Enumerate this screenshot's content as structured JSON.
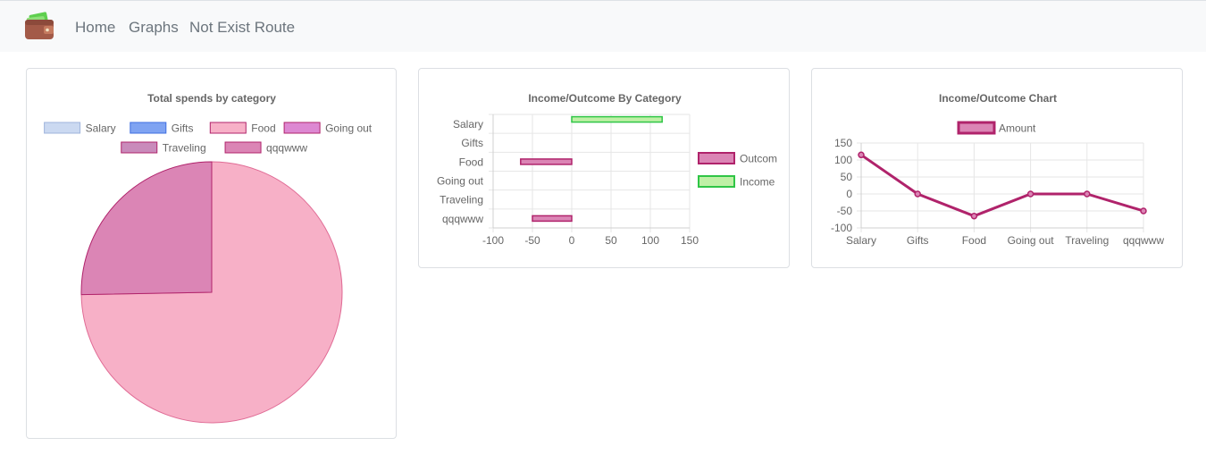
{
  "nav": {
    "links": [
      "Home",
      "Graphs",
      "Not Exist Route"
    ]
  },
  "icons": {
    "brand": "wallet-icon"
  },
  "colors": {
    "salary": "#cbd9f1",
    "gifts": "#7fa3f2",
    "food": "#f7b0c7",
    "going_out": "#dd88d2",
    "traveling": "#c98bbb",
    "qqqwww": "#db85b5",
    "outcome": "#db85b5",
    "outcome_border": "#b0236b",
    "income": "#bff0a6",
    "income_border": "#2fc546",
    "line": "#b0236b",
    "grid": "#e6e6e6"
  },
  "chart_data": [
    {
      "type": "pie",
      "title": "Total spends by category",
      "categories": [
        "Salary",
        "Gifts",
        "Food",
        "Going out",
        "Traveling",
        "qqqwww"
      ],
      "values": [
        0,
        0,
        65,
        0,
        0,
        22
      ],
      "legend": "top"
    },
    {
      "type": "bar",
      "orientation": "horizontal",
      "title": "Income/Outcome By Category",
      "categories": [
        "Salary",
        "Gifts",
        "Food",
        "Going out",
        "Traveling",
        "qqqwww"
      ],
      "series": [
        {
          "name": "Outcome",
          "values": [
            0,
            0,
            -65,
            0,
            0,
            -50
          ]
        },
        {
          "name": "Income",
          "values": [
            115,
            0,
            0,
            0,
            0,
            0
          ]
        }
      ],
      "xlim": [
        -100,
        150
      ],
      "xticks": [
        -100,
        -50,
        0,
        50,
        100,
        150
      ],
      "legend_labels": [
        "Outcom",
        "Income"
      ],
      "legend": "right",
      "grid": true
    },
    {
      "type": "line",
      "title": "Income/Outcome Chart",
      "categories": [
        "Salary",
        "Gifts",
        "Food",
        "Going out",
        "Traveling",
        "qqqwww"
      ],
      "series": [
        {
          "name": "Amount",
          "values": [
            115,
            0,
            -65,
            0,
            0,
            -50
          ]
        }
      ],
      "ylim": [
        -100,
        150
      ],
      "yticks": [
        150,
        100,
        50,
        0,
        -50,
        -100
      ],
      "legend": "top",
      "grid": true
    }
  ]
}
